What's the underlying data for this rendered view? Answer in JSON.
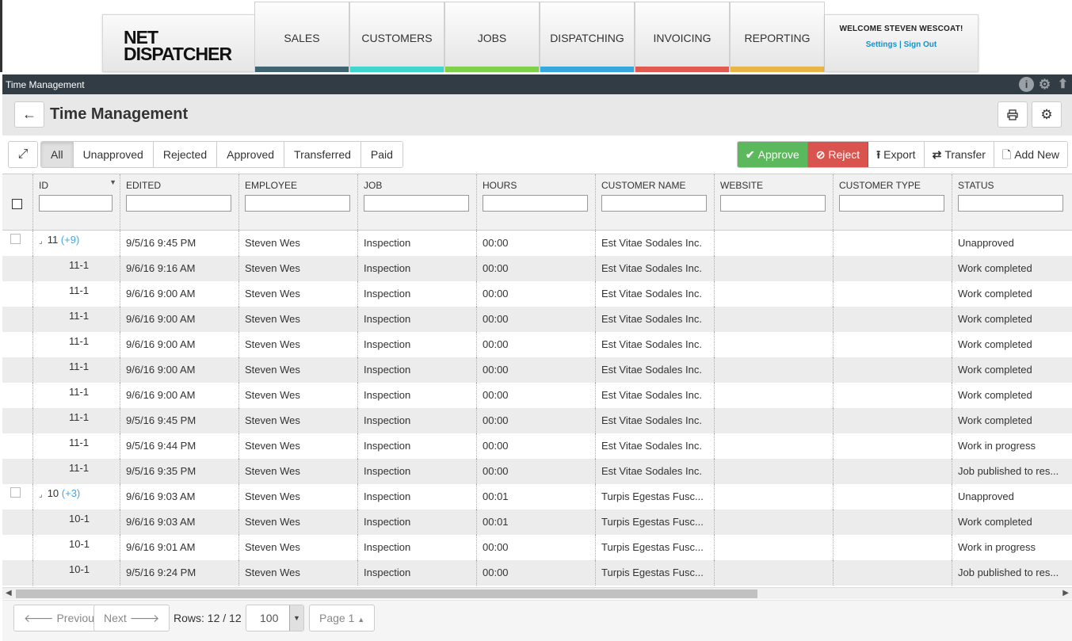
{
  "app": {
    "logo_line1": "NET",
    "logo_line2": "DISPATCHER",
    "welcome": "WELCOME STEVEN WESCOAT!",
    "settings_link": "Settings",
    "link_separator": "|",
    "signout_link": "Sign Out"
  },
  "nav": [
    {
      "label": "SALES",
      "color": "#3f6572"
    },
    {
      "label": "CUSTOMERS",
      "color": "#3fd6cf"
    },
    {
      "label": "JOBS",
      "color": "#7ed24c"
    },
    {
      "label": "DISPATCHING",
      "color": "#37a8de"
    },
    {
      "label": "INVOICING",
      "color": "#e05a52"
    },
    {
      "label": "REPORTING",
      "color": "#e8b548"
    }
  ],
  "strip": {
    "title": "Time Management",
    "icons": [
      "info-icon",
      "gear-icon",
      "arrow-up-icon"
    ]
  },
  "page": {
    "title": "Time Management",
    "back_icon": "arrow-left-icon",
    "print_icon": "print-icon",
    "settings_icon": "gear-icon"
  },
  "filters": {
    "items": [
      "All",
      "Unapproved",
      "Rejected",
      "Approved",
      "Transferred",
      "Paid"
    ],
    "active": "All"
  },
  "actions": {
    "approve": "Approve",
    "reject": "Reject",
    "export": "Export",
    "transfer": "Transfer",
    "add_new": "Add New"
  },
  "grid": {
    "columns": [
      "ID",
      "EDITED",
      "EMPLOYEE",
      "JOB",
      "HOURS",
      "CUSTOMER NAME",
      "WEBSITE",
      "CUSTOMER TYPE",
      "STATUS"
    ],
    "rows": [
      {
        "type": "parent",
        "id": "11",
        "count": "(+9)",
        "edited": "9/5/16 9:45 PM",
        "employee": "Steven Wes",
        "job": "Inspection",
        "hours": "00:00",
        "customer": "Est Vitae Sodales Inc.",
        "website": "",
        "ctype": "",
        "status": "Unapproved"
      },
      {
        "type": "child",
        "id": "11-1",
        "edited": "9/6/16 9:16 AM",
        "employee": "Steven Wes",
        "job": "Inspection",
        "hours": "00:00",
        "customer": "Est Vitae Sodales Inc.",
        "website": "",
        "ctype": "",
        "status": "Work completed"
      },
      {
        "type": "child",
        "id": "11-1",
        "edited": "9/6/16 9:00 AM",
        "employee": "Steven Wes",
        "job": "Inspection",
        "hours": "00:00",
        "customer": "Est Vitae Sodales Inc.",
        "website": "",
        "ctype": "",
        "status": "Work completed"
      },
      {
        "type": "child",
        "id": "11-1",
        "edited": "9/6/16 9:00 AM",
        "employee": "Steven Wes",
        "job": "Inspection",
        "hours": "00:00",
        "customer": "Est Vitae Sodales Inc.",
        "website": "",
        "ctype": "",
        "status": "Work completed"
      },
      {
        "type": "child",
        "id": "11-1",
        "edited": "9/6/16 9:00 AM",
        "employee": "Steven Wes",
        "job": "Inspection",
        "hours": "00:00",
        "customer": "Est Vitae Sodales Inc.",
        "website": "",
        "ctype": "",
        "status": "Work completed"
      },
      {
        "type": "child",
        "id": "11-1",
        "edited": "9/6/16 9:00 AM",
        "employee": "Steven Wes",
        "job": "Inspection",
        "hours": "00:00",
        "customer": "Est Vitae Sodales Inc.",
        "website": "",
        "ctype": "",
        "status": "Work completed"
      },
      {
        "type": "child",
        "id": "11-1",
        "edited": "9/6/16 9:00 AM",
        "employee": "Steven Wes",
        "job": "Inspection",
        "hours": "00:00",
        "customer": "Est Vitae Sodales Inc.",
        "website": "",
        "ctype": "",
        "status": "Work completed"
      },
      {
        "type": "child",
        "id": "11-1",
        "edited": "9/5/16 9:45 PM",
        "employee": "Steven Wes",
        "job": "Inspection",
        "hours": "00:00",
        "customer": "Est Vitae Sodales Inc.",
        "website": "",
        "ctype": "",
        "status": "Work completed"
      },
      {
        "type": "child",
        "id": "11-1",
        "edited": "9/5/16 9:44 PM",
        "employee": "Steven Wes",
        "job": "Inspection",
        "hours": "00:00",
        "customer": "Est Vitae Sodales Inc.",
        "website": "",
        "ctype": "",
        "status": "Work in progress"
      },
      {
        "type": "child",
        "id": "11-1",
        "edited": "9/5/16 9:35 PM",
        "employee": "Steven Wes",
        "job": "Inspection",
        "hours": "00:00",
        "customer": "Est Vitae Sodales Inc.",
        "website": "",
        "ctype": "",
        "status": "Job published to res..."
      },
      {
        "type": "parent",
        "id": "10",
        "count": "(+3)",
        "edited": "9/6/16 9:03 AM",
        "employee": "Steven Wes",
        "job": "Inspection",
        "hours": "00:01",
        "customer": "Turpis Egestas Fusc...",
        "website": "",
        "ctype": "",
        "status": "Unapproved"
      },
      {
        "type": "child",
        "id": "10-1",
        "edited": "9/6/16 9:03 AM",
        "employee": "Steven Wes",
        "job": "Inspection",
        "hours": "00:01",
        "customer": "Turpis Egestas Fusc...",
        "website": "",
        "ctype": "",
        "status": "Work completed"
      },
      {
        "type": "child",
        "id": "10-1",
        "edited": "9/6/16 9:01 AM",
        "employee": "Steven Wes",
        "job": "Inspection",
        "hours": "00:00",
        "customer": "Turpis Egestas Fusc...",
        "website": "",
        "ctype": "",
        "status": "Work in progress"
      },
      {
        "type": "child",
        "id": "10-1",
        "edited": "9/5/16 9:24 PM",
        "employee": "Steven Wes",
        "job": "Inspection",
        "hours": "00:00",
        "customer": "Turpis Egestas Fusc...",
        "website": "",
        "ctype": "",
        "status": "Job published to res..."
      }
    ]
  },
  "pager": {
    "previous": "Previous",
    "next": "Next",
    "rows_label": "Rows: 12 / 12",
    "page_size": "100",
    "page_label": "Page 1"
  }
}
